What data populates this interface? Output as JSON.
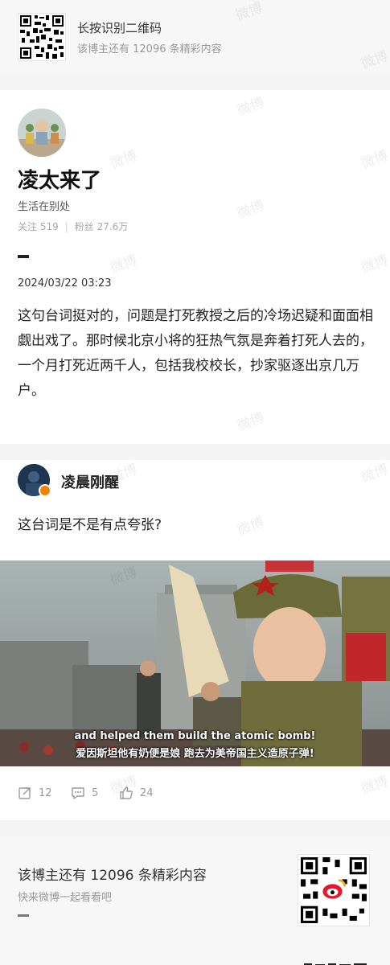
{
  "top_banner": {
    "title": "长按识别二维码",
    "subtitle": "该博主还有 12096 条精彩内容"
  },
  "post": {
    "author_name": "凌太来了",
    "bio": "生活在别处",
    "following_label": "关注 519",
    "followers_label": "粉丝 27.6万",
    "date": "2024/03/22 03:23",
    "body": "这句台词挺对的，问题是打死教授之后的冷场迟疑和面面相觑出戏了。那时候北京小将的狂热气氛是奔着打死人去的，一个月打死近两千人，包括我校校长，抄家驱逐出京几万户。"
  },
  "repost": {
    "author_name": "凌晨刚醒",
    "text": "这台词是不是有点夸张?",
    "subtitle_en": "and helped them build the atomic bomb!",
    "subtitle_zh": "爱因斯坦他有奶便是娘 跑去为美帝国主义造原子弹!"
  },
  "actions": {
    "share_count": "12",
    "comment_count": "5",
    "like_count": "24"
  },
  "footer": {
    "title": "该博主还有 12096 条精彩内容",
    "subtitle": "快来微博一起看看吧"
  },
  "watermark": "微博",
  "icons": [
    "qr-code-icon",
    "share-icon",
    "comment-icon",
    "like-icon",
    "verified-badge-icon"
  ],
  "colors": {
    "verify_badge": "#f08300",
    "weibo_red": "#e6162d"
  }
}
